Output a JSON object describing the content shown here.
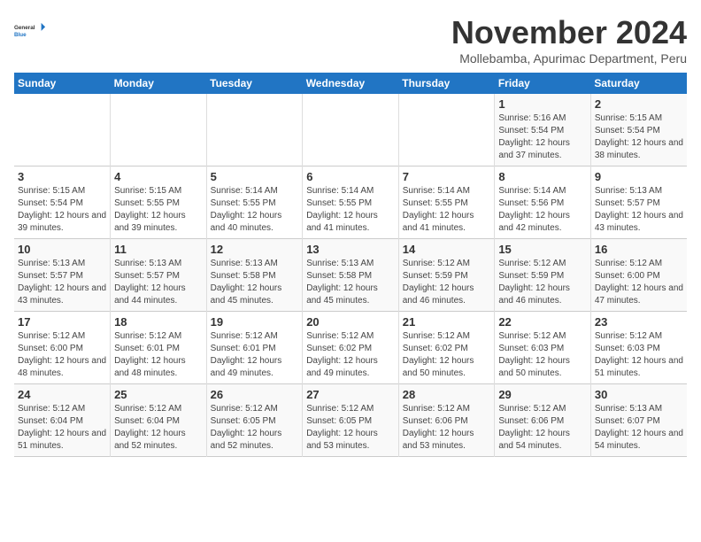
{
  "header": {
    "logo": {
      "general": "General",
      "blue": "Blue"
    },
    "title": "November 2024",
    "subtitle": "Mollebamba, Apurimac Department, Peru"
  },
  "weekdays": [
    "Sunday",
    "Monday",
    "Tuesday",
    "Wednesday",
    "Thursday",
    "Friday",
    "Saturday"
  ],
  "weeks": [
    [
      {
        "day": "",
        "info": ""
      },
      {
        "day": "",
        "info": ""
      },
      {
        "day": "",
        "info": ""
      },
      {
        "day": "",
        "info": ""
      },
      {
        "day": "",
        "info": ""
      },
      {
        "day": "1",
        "info": "Sunrise: 5:16 AM\nSunset: 5:54 PM\nDaylight: 12 hours and 37 minutes."
      },
      {
        "day": "2",
        "info": "Sunrise: 5:15 AM\nSunset: 5:54 PM\nDaylight: 12 hours and 38 minutes."
      }
    ],
    [
      {
        "day": "3",
        "info": "Sunrise: 5:15 AM\nSunset: 5:54 PM\nDaylight: 12 hours and 39 minutes."
      },
      {
        "day": "4",
        "info": "Sunrise: 5:15 AM\nSunset: 5:55 PM\nDaylight: 12 hours and 39 minutes."
      },
      {
        "day": "5",
        "info": "Sunrise: 5:14 AM\nSunset: 5:55 PM\nDaylight: 12 hours and 40 minutes."
      },
      {
        "day": "6",
        "info": "Sunrise: 5:14 AM\nSunset: 5:55 PM\nDaylight: 12 hours and 41 minutes."
      },
      {
        "day": "7",
        "info": "Sunrise: 5:14 AM\nSunset: 5:55 PM\nDaylight: 12 hours and 41 minutes."
      },
      {
        "day": "8",
        "info": "Sunrise: 5:14 AM\nSunset: 5:56 PM\nDaylight: 12 hours and 42 minutes."
      },
      {
        "day": "9",
        "info": "Sunrise: 5:13 AM\nSunset: 5:57 PM\nDaylight: 12 hours and 43 minutes."
      }
    ],
    [
      {
        "day": "10",
        "info": "Sunrise: 5:13 AM\nSunset: 5:57 PM\nDaylight: 12 hours and 43 minutes."
      },
      {
        "day": "11",
        "info": "Sunrise: 5:13 AM\nSunset: 5:57 PM\nDaylight: 12 hours and 44 minutes."
      },
      {
        "day": "12",
        "info": "Sunrise: 5:13 AM\nSunset: 5:58 PM\nDaylight: 12 hours and 45 minutes."
      },
      {
        "day": "13",
        "info": "Sunrise: 5:13 AM\nSunset: 5:58 PM\nDaylight: 12 hours and 45 minutes."
      },
      {
        "day": "14",
        "info": "Sunrise: 5:12 AM\nSunset: 5:59 PM\nDaylight: 12 hours and 46 minutes."
      },
      {
        "day": "15",
        "info": "Sunrise: 5:12 AM\nSunset: 5:59 PM\nDaylight: 12 hours and 46 minutes."
      },
      {
        "day": "16",
        "info": "Sunrise: 5:12 AM\nSunset: 6:00 PM\nDaylight: 12 hours and 47 minutes."
      }
    ],
    [
      {
        "day": "17",
        "info": "Sunrise: 5:12 AM\nSunset: 6:00 PM\nDaylight: 12 hours and 48 minutes."
      },
      {
        "day": "18",
        "info": "Sunrise: 5:12 AM\nSunset: 6:01 PM\nDaylight: 12 hours and 48 minutes."
      },
      {
        "day": "19",
        "info": "Sunrise: 5:12 AM\nSunset: 6:01 PM\nDaylight: 12 hours and 49 minutes."
      },
      {
        "day": "20",
        "info": "Sunrise: 5:12 AM\nSunset: 6:02 PM\nDaylight: 12 hours and 49 minutes."
      },
      {
        "day": "21",
        "info": "Sunrise: 5:12 AM\nSunset: 6:02 PM\nDaylight: 12 hours and 50 minutes."
      },
      {
        "day": "22",
        "info": "Sunrise: 5:12 AM\nSunset: 6:03 PM\nDaylight: 12 hours and 50 minutes."
      },
      {
        "day": "23",
        "info": "Sunrise: 5:12 AM\nSunset: 6:03 PM\nDaylight: 12 hours and 51 minutes."
      }
    ],
    [
      {
        "day": "24",
        "info": "Sunrise: 5:12 AM\nSunset: 6:04 PM\nDaylight: 12 hours and 51 minutes."
      },
      {
        "day": "25",
        "info": "Sunrise: 5:12 AM\nSunset: 6:04 PM\nDaylight: 12 hours and 52 minutes."
      },
      {
        "day": "26",
        "info": "Sunrise: 5:12 AM\nSunset: 6:05 PM\nDaylight: 12 hours and 52 minutes."
      },
      {
        "day": "27",
        "info": "Sunrise: 5:12 AM\nSunset: 6:05 PM\nDaylight: 12 hours and 53 minutes."
      },
      {
        "day": "28",
        "info": "Sunrise: 5:12 AM\nSunset: 6:06 PM\nDaylight: 12 hours and 53 minutes."
      },
      {
        "day": "29",
        "info": "Sunrise: 5:12 AM\nSunset: 6:06 PM\nDaylight: 12 hours and 54 minutes."
      },
      {
        "day": "30",
        "info": "Sunrise: 5:13 AM\nSunset: 6:07 PM\nDaylight: 12 hours and 54 minutes."
      }
    ]
  ]
}
